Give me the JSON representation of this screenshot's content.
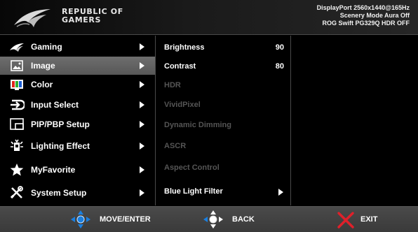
{
  "header": {
    "brand_line1": "REPUBLIC OF",
    "brand_line2": "GAMERS",
    "status": [
      "DisplayPort 2560x1440@165Hz",
      "Scenery Mode Aura Off",
      "ROG Swift PG329Q HDR OFF"
    ]
  },
  "main_menu": {
    "items": [
      {
        "label": "Gaming",
        "icon": "rog-eye-icon"
      },
      {
        "label": "Image",
        "icon": "image-icon",
        "selected": true
      },
      {
        "label": "Color",
        "icon": "color-icon"
      },
      {
        "label": "Input Select",
        "icon": "input-icon"
      },
      {
        "label": "PIP/PBP Setup",
        "icon": "pip-icon"
      },
      {
        "label": "Lighting Effect",
        "icon": "lighting-icon"
      },
      {
        "label": "MyFavorite",
        "icon": "star-icon"
      },
      {
        "label": "System Setup",
        "icon": "wrench-icon"
      }
    ]
  },
  "submenu": {
    "items": [
      {
        "label": "Brightness",
        "value": "90",
        "enabled": true
      },
      {
        "label": "Contrast",
        "value": "80",
        "enabled": true
      },
      {
        "label": "HDR",
        "enabled": false
      },
      {
        "label": "VividPixel",
        "enabled": false
      },
      {
        "label": "Dynamic Dimming",
        "enabled": false
      },
      {
        "label": "ASCR",
        "enabled": false
      },
      {
        "label": "Aspect Control",
        "enabled": false
      },
      {
        "label": "Blue Light Filter",
        "enabled": true,
        "has_submenu": true
      }
    ]
  },
  "footer": {
    "move_label": "MOVE/ENTER",
    "back_label": "BACK",
    "exit_label": "EXIT"
  },
  "colors": {
    "nav_blue": "#1a7fe0",
    "exit_red": "#e0202a",
    "selected_bg": "#656565",
    "disabled_text": "#555555"
  }
}
